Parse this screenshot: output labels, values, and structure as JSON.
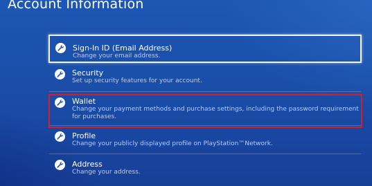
{
  "header": {
    "title": "Account Information"
  },
  "menu": {
    "items": [
      {
        "label": "Sign-In ID (Email Address)",
        "description": "Change your email address.",
        "icon": "wrench-icon"
      },
      {
        "label": "Security",
        "description": "Set up security features for your account.",
        "icon": "wrench-icon"
      },
      {
        "label": "Wallet",
        "description": "Change your payment methods and purchase settings, including the password requirement for purchases.",
        "icon": "wrench-icon"
      },
      {
        "label": "Profile",
        "description": "Change your publicly displayed profile on PlayStation™Network.",
        "icon": "wrench-icon"
      },
      {
        "label": "Address",
        "description": "Change your address.",
        "icon": "wrench-icon"
      }
    ]
  },
  "colors": {
    "background": "#1a4ea9",
    "focus_border": "#f2f6ff",
    "highlight_box": "#d41f2a",
    "description_text": "#b9cdee"
  }
}
